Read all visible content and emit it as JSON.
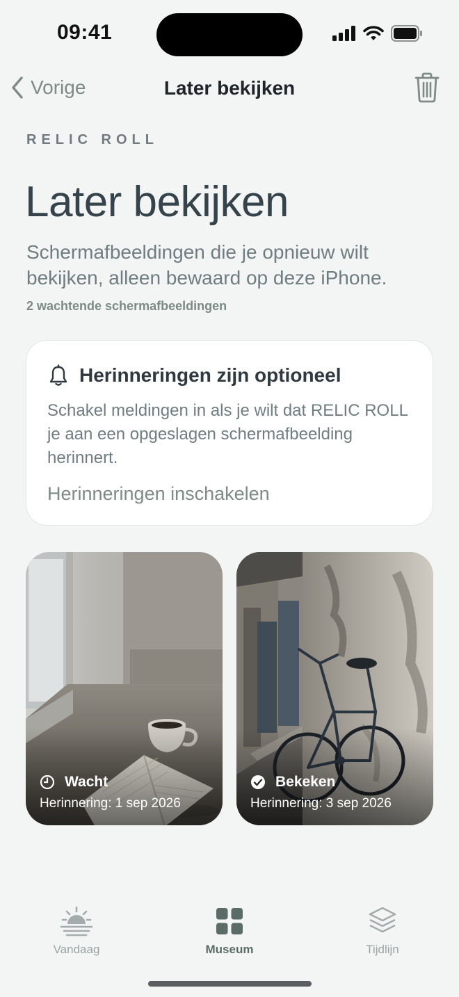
{
  "status_bar": {
    "time": "09:41"
  },
  "nav": {
    "back_label": "Vorige",
    "title": "Later bekijken",
    "trash_icon": "trash-icon"
  },
  "header": {
    "brand": "RELIC ROLL",
    "title": "Later bekijken",
    "subtitle": "Schermafbeeldingen die je opnieuw wilt bekijken, alleen bewaard op deze iPhone.",
    "count": "2 wachtende schermafbeeldingen"
  },
  "reminder_card": {
    "icon": "bell-icon",
    "title": "Herinneringen zijn optioneel",
    "body": "Schakel meldingen in als je wilt dat RELIC ROLL je aan een opgeslagen schermafbeelding herinnert.",
    "action": "Herinneringen inschakelen"
  },
  "tiles": [
    {
      "status": "Wacht",
      "status_icon": "clock-icon",
      "reminder": "Herinnering: 1 sep 2026"
    },
    {
      "status": "Bekeken",
      "status_icon": "checkmark-circle-icon",
      "reminder": "Herinnering: 3 sep 2026"
    }
  ],
  "tab_bar": {
    "items": [
      {
        "label": "Vandaag",
        "icon": "sunrise-icon"
      },
      {
        "label": "Museum",
        "icon": "grid-icon",
        "active": true
      },
      {
        "label": "Tijdlijn",
        "icon": "stack-icon"
      }
    ]
  },
  "colors": {
    "background": "#f3f5f4",
    "accent": "#5b6c68",
    "text": "#2f3a40",
    "muted": "#7d8a86"
  }
}
